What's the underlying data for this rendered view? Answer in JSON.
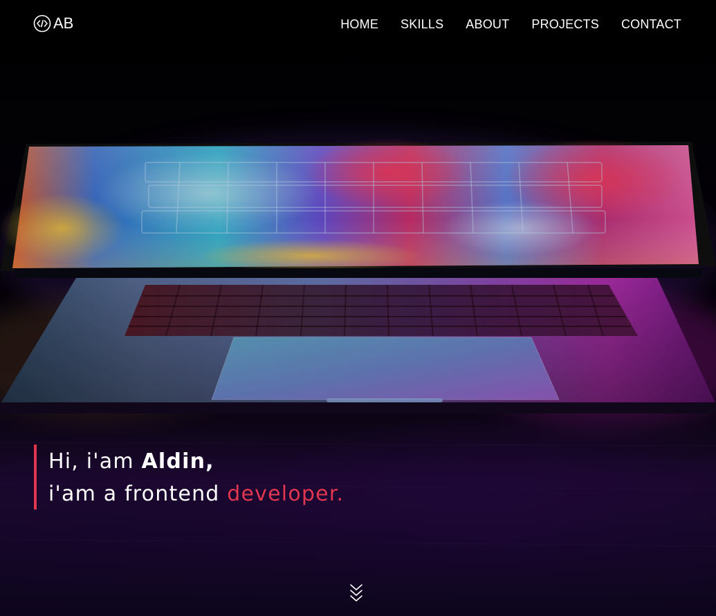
{
  "logo": {
    "icon": "code-brackets-icon",
    "text": "AB"
  },
  "nav": {
    "items": [
      {
        "label": "HOME"
      },
      {
        "label": "SKILLS"
      },
      {
        "label": "ABOUT"
      },
      {
        "label": "PROJECTS"
      },
      {
        "label": "CONTACT"
      }
    ]
  },
  "hero": {
    "greeting": "Hi, i'am",
    "name": "Aldin",
    "name_suffix": ",",
    "role_prefix": "i'am a frontend",
    "role_accent": "developer.",
    "scroll_icon": "chevrons-down-icon"
  },
  "colors": {
    "accent": "#e0364f",
    "text": "#ffffff",
    "background": "#000000"
  }
}
